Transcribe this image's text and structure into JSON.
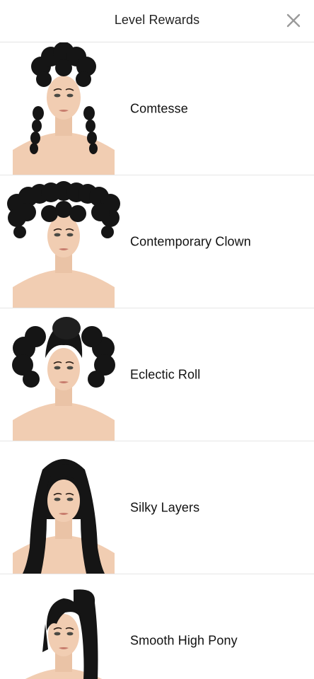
{
  "header": {
    "title": "Level Rewards",
    "close_icon": "close-icon"
  },
  "colors": {
    "hair": "#151515",
    "skin": "#f1cdb2",
    "divider": "#e6e6e6",
    "close_icon": "#9a9a9a"
  },
  "rewards": [
    {
      "name": "Comtesse",
      "hair_style": "comtesse"
    },
    {
      "name": "Contemporary Clown",
      "hair_style": "clown"
    },
    {
      "name": "Eclectic Roll",
      "hair_style": "roll"
    },
    {
      "name": "Silky Layers",
      "hair_style": "layers"
    },
    {
      "name": "Smooth High Pony",
      "hair_style": "pony"
    }
  ]
}
